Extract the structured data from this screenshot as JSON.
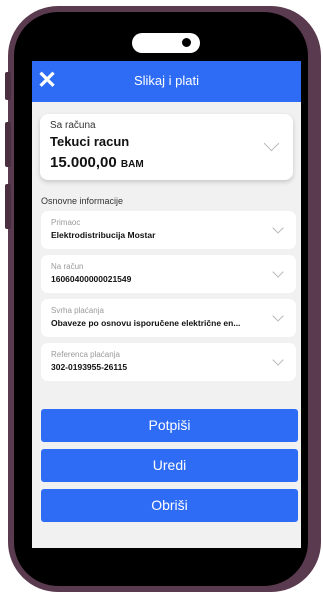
{
  "header": {
    "title": "Slikaj i plati",
    "close_icon": "close-icon"
  },
  "account": {
    "label": "Sa računa",
    "name": "Tekuci racun",
    "amount": "15.000,00",
    "currency": "BAM"
  },
  "section": {
    "title": "Osnovne informacije"
  },
  "fields": [
    {
      "label": "Primaoc",
      "value": "Elektrodistribucija Mostar"
    },
    {
      "label": "Na račun",
      "value": "16060400000021549"
    },
    {
      "label": "Svrha plaćanja",
      "value": "Obaveze po osnovu isporučene električne en..."
    },
    {
      "label": "Referenca plaćanja",
      "value": "302-0193955-26115"
    }
  ],
  "actions": {
    "sign": "Potpiši",
    "edit": "Uredi",
    "delete": "Obriši"
  },
  "colors": {
    "accent": "#2e6cf6",
    "frame": "#5a3a4e",
    "background": "#f1f1f1"
  }
}
